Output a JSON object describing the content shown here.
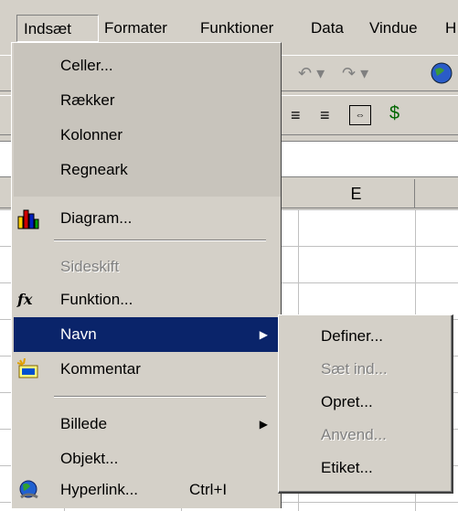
{
  "menubar": {
    "items": [
      {
        "label": "Indsæt"
      },
      {
        "label": "Formater"
      },
      {
        "label": "Funktioner"
      },
      {
        "label": "Data"
      },
      {
        "label": "Vindue"
      },
      {
        "label": "H"
      }
    ]
  },
  "sheet": {
    "column_header": "E"
  },
  "insert_menu": {
    "items": [
      {
        "label": "Celler...",
        "icon": null,
        "state": "rarely-used"
      },
      {
        "label": "Rækker",
        "state": "rarely-used"
      },
      {
        "label": "Kolonner",
        "state": "rarely-used"
      },
      {
        "label": "Regneark",
        "state": "rarely-used"
      },
      {
        "label": "Diagram...",
        "icon": "chart-wizard-icon"
      },
      {
        "label": "Sideskift",
        "state": "disabled"
      },
      {
        "label": "Funktion...",
        "icon": "function-fx-icon"
      },
      {
        "label": "Navn",
        "state": "selected",
        "has_submenu": true
      },
      {
        "label": "Kommentar",
        "icon": "comment-icon"
      },
      {
        "label": "Billede",
        "has_submenu": true
      },
      {
        "label": "Objekt..."
      },
      {
        "label": "Hyperlink...",
        "shortcut": "Ctrl+I",
        "icon": "hyperlink-globe-icon"
      }
    ]
  },
  "name_submenu": {
    "items": [
      {
        "label": "Definer...",
        "state": "enabled"
      },
      {
        "label": "Sæt ind...",
        "state": "disabled"
      },
      {
        "label": "Opret...",
        "state": "enabled"
      },
      {
        "label": "Anvend...",
        "state": "disabled"
      },
      {
        "label": "Etiket...",
        "state": "enabled"
      }
    ]
  },
  "colors": {
    "face": "#d4d0c8",
    "highlight": "#0a246a",
    "rarely_used": "#c8c4bc"
  }
}
